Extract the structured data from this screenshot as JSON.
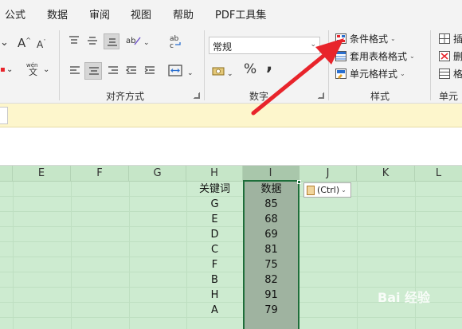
{
  "menu": {
    "tabs": [
      "公式",
      "数据",
      "审阅",
      "视图",
      "帮助",
      "PDF工具集"
    ]
  },
  "ribbon": {
    "font_group": {
      "wen_label": "wén",
      "wen_char": "文"
    },
    "alignment_group": {
      "label": "对齐方式"
    },
    "number_group": {
      "label": "数字",
      "format_value": "常规",
      "percent": "%",
      "comma": ","
    },
    "styles_group": {
      "label": "样式",
      "conditional_format": "条件格式",
      "format_as_table": "套用表格格式",
      "cell_styles": "单元格样式"
    },
    "cells_group": {
      "label": "单元",
      "insert": "插",
      "delete": "删",
      "format": "格"
    }
  },
  "sheet": {
    "columns": [
      "E",
      "F",
      "G",
      "H",
      "I",
      "J",
      "K",
      "L"
    ],
    "header_row": {
      "H": "关键词",
      "I": "数据"
    },
    "rows": [
      {
        "key": "G",
        "value": "85"
      },
      {
        "key": "E",
        "value": "68"
      },
      {
        "key": "D",
        "value": "69"
      },
      {
        "key": "C",
        "value": "81"
      },
      {
        "key": "F",
        "value": "75"
      },
      {
        "key": "B",
        "value": "82"
      },
      {
        "key": "H",
        "value": "91"
      },
      {
        "key": "A",
        "value": "79"
      }
    ],
    "paste_options_label": "(Ctrl)"
  },
  "colors": {
    "accent_red": "#e8242b",
    "selection_green": "#1e6e3a",
    "sheet_tint": "#cdebd0"
  },
  "watermark": "Bai 经验"
}
